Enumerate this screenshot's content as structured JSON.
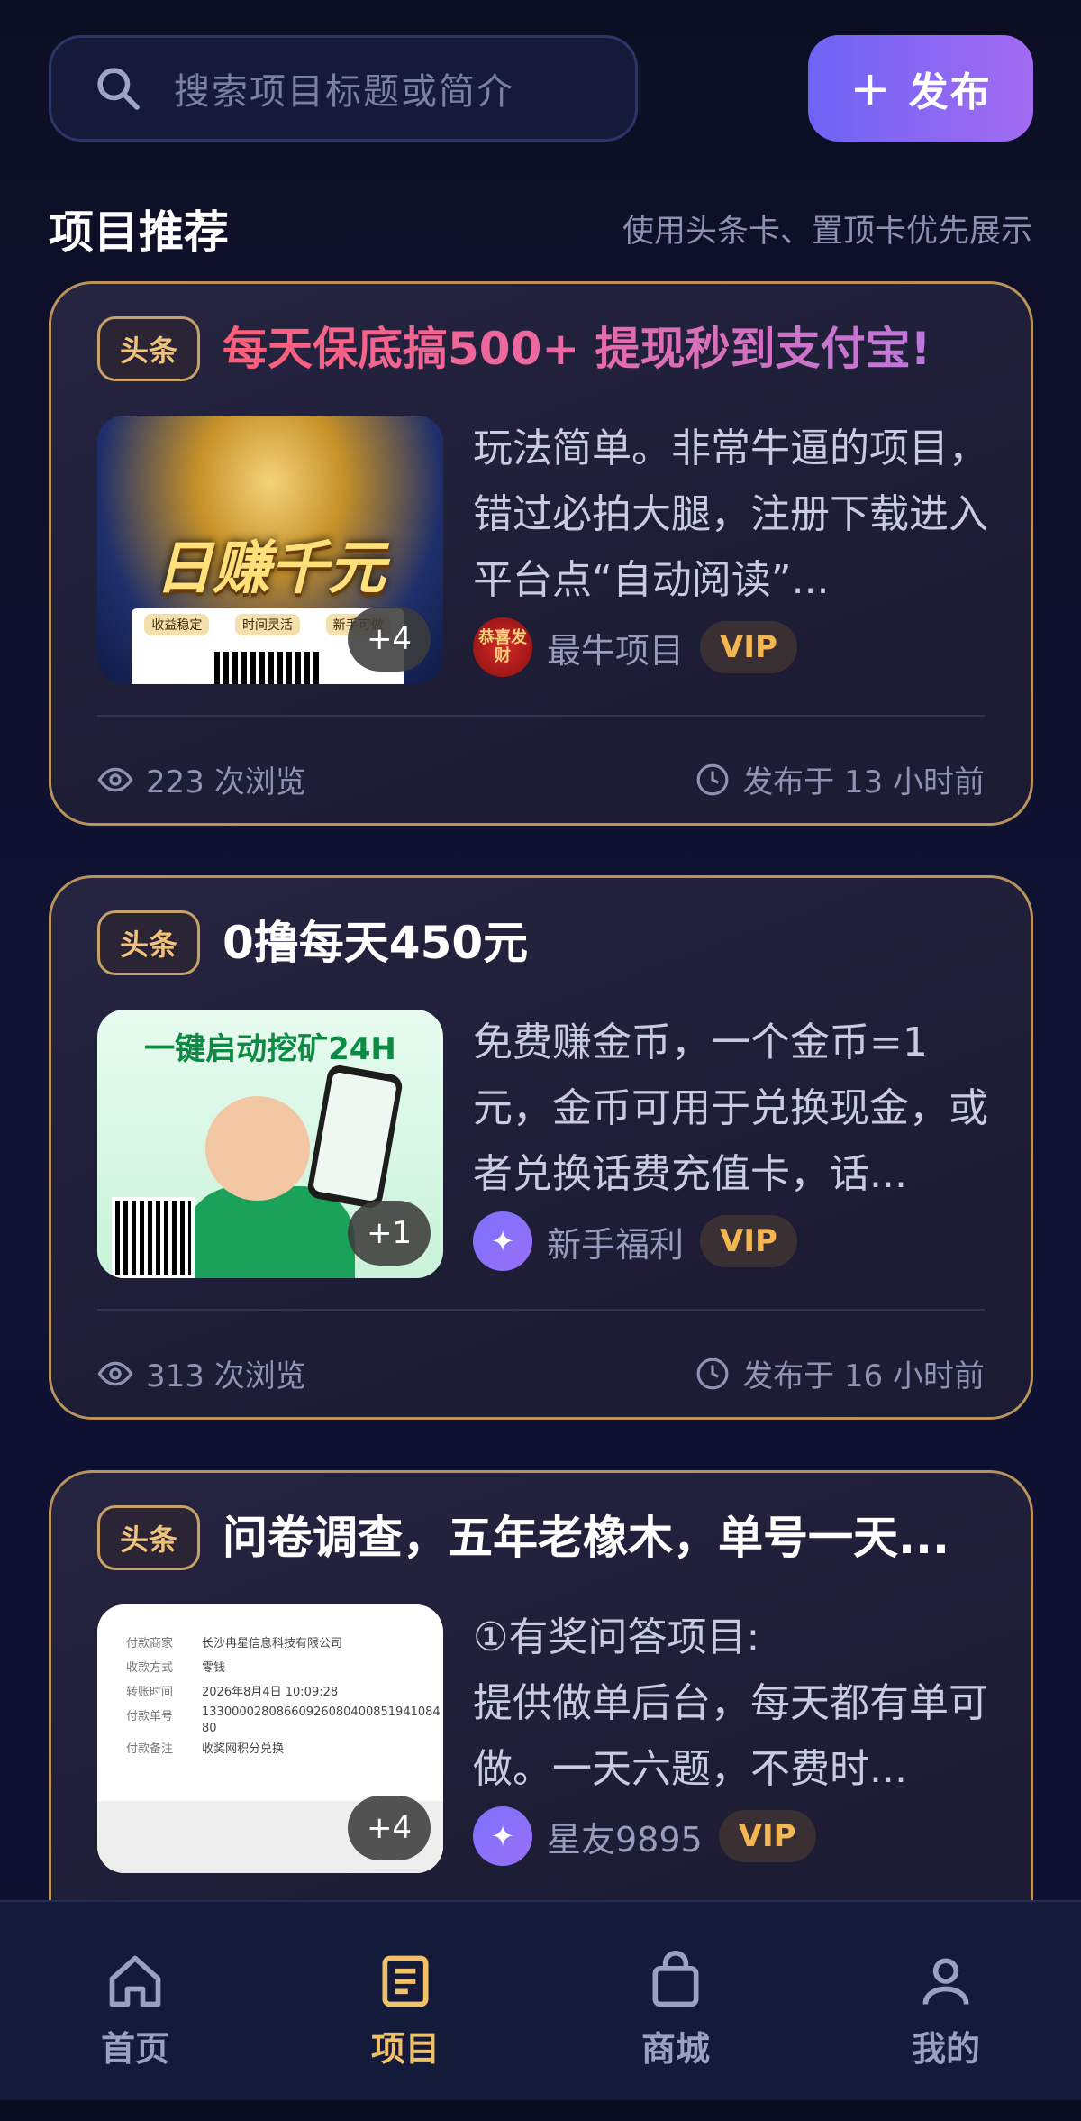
{
  "search": {
    "placeholder": "搜索项目标题或简介"
  },
  "publish": {
    "plus": "+",
    "label": "发布"
  },
  "section": {
    "title": "项目推荐",
    "hint": "使用头条卡、置顶卡优先展示"
  },
  "cards": [
    {
      "tag": "头条",
      "title": "每天保底搞500+ 提现秒到支付宝!",
      "thumb_text": "日赚千元",
      "thumb_chips": [
        "收益稳定",
        "时间灵活",
        "新手可做"
      ],
      "more": "+4",
      "desc": "玩法简单。非常牛逼的项目，错过必拍大腿，注册下载进入平台点“自动阅读”...",
      "author": "最牛项目",
      "avatar_text": "恭喜发财",
      "vip": "VIP",
      "views": "223 次浏览",
      "time": "发布于 13 小时前"
    },
    {
      "tag": "头条",
      "title": "0撸每天450元",
      "thumb_text": "一键启动挖矿24H",
      "more": "+1",
      "desc": "免费赚金币，一个金币=1元，金币可用于兑换现金，或者兑换话费充值卡，话...",
      "author": "新手福利",
      "avatar_text": "✦",
      "vip": "VIP",
      "views": "313 次浏览",
      "time": "发布于 16 小时前"
    },
    {
      "tag": "头条",
      "title": "问卷调查，五年老橡木，单号一天...",
      "receipt": [
        {
          "k": "付款商家",
          "v": "长沙冉星信息科技有限公司"
        },
        {
          "k": "收款方式",
          "v": "零钱"
        },
        {
          "k": "转账时间",
          "v": "2026年8月4日 10:09:28"
        },
        {
          "k": "付款单号",
          "v": "13300002808660926080400851941084 80"
        },
        {
          "k": "付款备注",
          "v": "收奖网积分兑换"
        }
      ],
      "more": "+4",
      "desc": "①有奖问答项目:\n提供做单后台，每天都有单可做。一天六题，不费时...",
      "author": "星友9895",
      "avatar_text": "✦",
      "vip": "VIP"
    }
  ],
  "nav": [
    {
      "label": "首页",
      "icon": "home-icon"
    },
    {
      "label": "项目",
      "icon": "document-icon"
    },
    {
      "label": "商城",
      "icon": "shopping-bag-icon"
    },
    {
      "label": "我的",
      "icon": "user-icon"
    }
  ],
  "colors": {
    "accent": "#f1c06a",
    "publish_start": "#6e63f5",
    "publish_end": "#a36bf1",
    "card_border": "#b8935b",
    "vip": "#f3b650"
  }
}
